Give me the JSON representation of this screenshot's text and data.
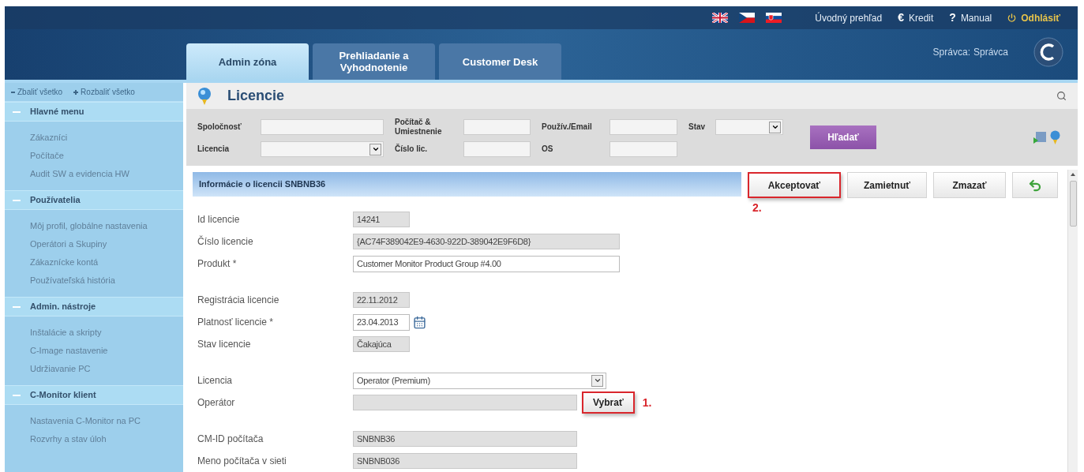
{
  "header": {
    "top_links": [
      {
        "kind": "home",
        "label": "Úvodný prehľad"
      },
      {
        "kind": "credit",
        "icon": "€",
        "label": "Kredit"
      },
      {
        "kind": "help",
        "icon": "?",
        "label": "Manual"
      },
      {
        "kind": "logout",
        "label": "Odhlásiť"
      }
    ],
    "tabs": [
      {
        "label": "Admin zóna",
        "selected": true
      },
      {
        "label": "Prehliadanie a Vyhodnotenie",
        "selected": false
      },
      {
        "label": "Customer Desk",
        "selected": false
      }
    ],
    "user": {
      "role": "Správca:",
      "name": "Správca"
    }
  },
  "sidebar": {
    "collapse_all": "Zbaliť všetko",
    "expand_all": "Rozbaliť všetko",
    "sections": [
      {
        "title": "Hlavné menu",
        "expanded": true,
        "items": [
          "Zákazníci",
          "Počítače",
          "Audit SW a evidencia HW"
        ]
      },
      {
        "title": "Používatelia",
        "expanded": true,
        "items": [
          "Môj profil, globálne nastavenia",
          "Operátori a Skupiny",
          "Zákaznícke kontá",
          "Používateľská história"
        ]
      },
      {
        "title": "Admin. nástroje",
        "expanded": true,
        "items": [
          "Inštalácie a skripty",
          "C-Image nastavenie",
          "Udržiavanie PC"
        ]
      },
      {
        "title": "C-Monitor klient",
        "expanded": true,
        "items": [
          "Nastavenia C-Monitor na PC",
          "Rozvrhy a stav úloh"
        ]
      }
    ]
  },
  "page": {
    "title": "Licencie",
    "filters": [
      {
        "label": "Spoločnosť",
        "kind": "text"
      },
      {
        "label": "Počítač & Umiestnenie",
        "kind": "text"
      },
      {
        "label": "Použív./Email",
        "kind": "text"
      },
      {
        "label": "Stav",
        "kind": "select"
      },
      {
        "label": "Licencia",
        "kind": "select"
      },
      {
        "label": "Číslo lic.",
        "kind": "text"
      },
      {
        "label": "OS",
        "kind": "text"
      }
    ],
    "search_button": "Hľadať",
    "detail": {
      "title": "Informácie o licencii SNBNB36",
      "actions": [
        {
          "kind": "text",
          "label": "Akceptovať",
          "highlighted": true,
          "annotation": "2."
        },
        {
          "kind": "text",
          "label": "Zamietnuť",
          "highlighted": false
        },
        {
          "kind": "text",
          "label": "Zmazať",
          "highlighted": false
        },
        {
          "kind": "back",
          "highlighted": false
        }
      ],
      "groups": [
        [
          {
            "label": "Id licencie",
            "kind": "short",
            "value": "14241"
          },
          {
            "label": "Číslo licencie",
            "kind": "wide",
            "value": "{AC74F389042E9-4630-922D-389042E9F6D8}"
          },
          {
            "label": "Produkt *",
            "kind": "text",
            "value": "Customer Monitor Product Group #4.00"
          }
        ],
        [
          {
            "label": "Registrácia licencie",
            "kind": "short",
            "value": "22.11.2012"
          },
          {
            "label": "Platnosť licencie *",
            "kind": "date",
            "value": "23.04.2013"
          },
          {
            "label": "Stav licencie",
            "kind": "short",
            "value": "Čakajúca"
          }
        ],
        [
          {
            "label": "Licencia",
            "kind": "select",
            "value": "Operator (Premium)"
          },
          {
            "label": "Operátor",
            "kind": "picker",
            "button": "Vybrať",
            "highlighted": true,
            "annotation": "1."
          }
        ],
        [
          {
            "label": "CM-ID počítača",
            "kind": "medium",
            "value": "SNBNB36"
          },
          {
            "label": "Meno počítača v sieti",
            "kind": "medium",
            "value": "SNBNB036"
          }
        ]
      ]
    }
  }
}
